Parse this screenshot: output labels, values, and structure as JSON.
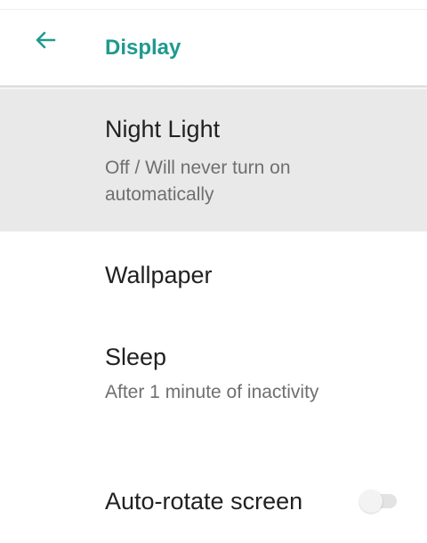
{
  "app_bar": {
    "back_icon": "arrow-left-icon",
    "title": "Display",
    "accent_color": "#1e9a8f"
  },
  "settings": {
    "night_light": {
      "title": "Night Light",
      "summary": "Off / Will never turn on automatically",
      "selected": true
    },
    "wallpaper": {
      "title": "Wallpaper"
    },
    "sleep": {
      "title": "Sleep",
      "summary": "After 1 minute of inactivity"
    },
    "auto_rotate": {
      "title": "Auto-rotate screen",
      "enabled": false
    }
  }
}
